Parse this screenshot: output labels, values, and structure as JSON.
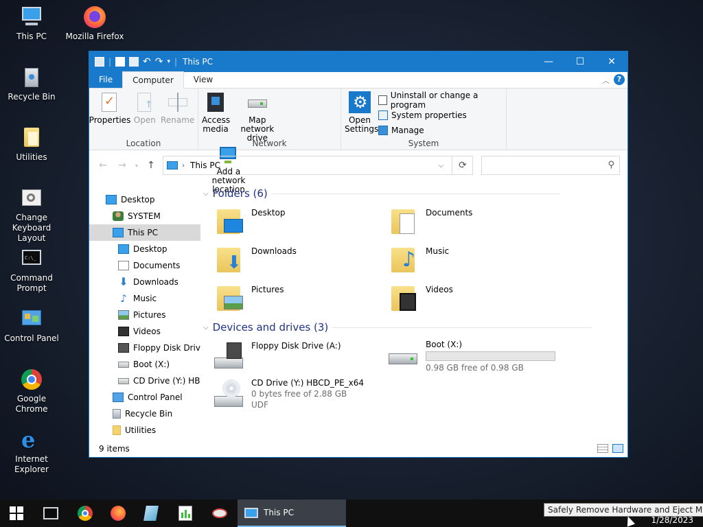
{
  "desktop": {
    "icons": [
      {
        "label": "This PC"
      },
      {
        "label": "Mozilla Firefox"
      },
      {
        "label": "Recycle Bin"
      },
      {
        "label": "Utilities"
      },
      {
        "label": "Change Keyboard Layout"
      },
      {
        "label": "Command Prompt"
      },
      {
        "label": "Control Panel"
      },
      {
        "label": "Google Chrome"
      },
      {
        "label": "Internet Explorer"
      }
    ]
  },
  "window": {
    "title": "This PC",
    "controls": {
      "minimize": "—",
      "maximize": "☐",
      "close": "✕"
    },
    "tabs": {
      "file": "File",
      "computer": "Computer",
      "view": "View"
    },
    "ribbon": {
      "location": {
        "label": "Location",
        "properties": "Properties",
        "open": "Open",
        "rename": "Rename"
      },
      "network": {
        "label": "Network",
        "access_media": "Access media",
        "map_drive": "Map network drive",
        "add_location": "Add a network location"
      },
      "system": {
        "label": "System",
        "open_settings": "Open Settings",
        "uninstall": "Uninstall or change a program",
        "system_properties": "System properties",
        "manage": "Manage"
      }
    },
    "address": {
      "path": "This PC"
    },
    "nav_pane": {
      "items": [
        {
          "label": "Desktop"
        },
        {
          "label": "SYSTEM"
        },
        {
          "label": "This PC"
        },
        {
          "label": "Desktop"
        },
        {
          "label": "Documents"
        },
        {
          "label": "Downloads"
        },
        {
          "label": "Music"
        },
        {
          "label": "Pictures"
        },
        {
          "label": "Videos"
        },
        {
          "label": "Floppy Disk Drive"
        },
        {
          "label": "Boot (X:)"
        },
        {
          "label": "CD Drive (Y:) HBC"
        },
        {
          "label": "Control Panel"
        },
        {
          "label": "Recycle Bin"
        },
        {
          "label": "Utilities"
        }
      ]
    },
    "folders": {
      "header": "Folders (6)",
      "items": [
        {
          "label": "Desktop"
        },
        {
          "label": "Documents"
        },
        {
          "label": "Downloads"
        },
        {
          "label": "Music"
        },
        {
          "label": "Pictures"
        },
        {
          "label": "Videos"
        }
      ]
    },
    "devices": {
      "header": "Devices and drives (3)",
      "items": [
        {
          "label": "Floppy Disk Drive (A:)",
          "detail": "",
          "detail2": ""
        },
        {
          "label": "Boot (X:)",
          "detail": "0.98 GB free of 0.98 GB",
          "detail2": "",
          "used_fraction": 0.0
        },
        {
          "label": "CD Drive (Y:) HBCD_PE_x64",
          "detail": "0 bytes free of 2.88 GB",
          "detail2": "UDF"
        }
      ]
    },
    "status": {
      "item_count": "9 items"
    }
  },
  "taskbar": {
    "active_label": "This PC",
    "tooltip": "Safely Remove Hardware and Eject Media",
    "date": "1/28/2023"
  },
  "colors": {
    "accent": "#1979ca",
    "section_header": "#1e3287",
    "taskbar": "#101010"
  }
}
